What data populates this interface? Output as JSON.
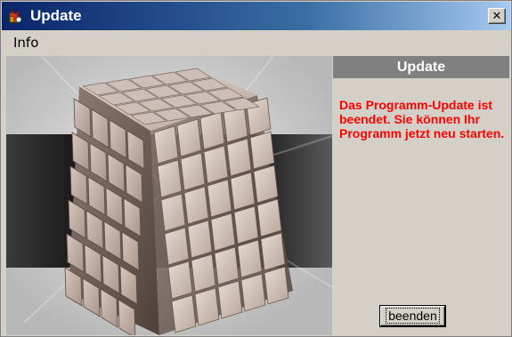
{
  "window": {
    "title": "Update",
    "title_icon": "update-app-icon",
    "close_icon": "close-icon",
    "close_glyph": "✕"
  },
  "menu": {
    "items": [
      {
        "label": "Info"
      }
    ]
  },
  "image": {
    "subject": "cube-image"
  },
  "panel": {
    "header": "Update",
    "message": "Das Programm-Update ist beendet. Sie können Ihr Programm jetzt neu starten.",
    "finish_button_label": "beenden"
  },
  "colors": {
    "title_gradient_start": "#0a246a",
    "title_gradient_end": "#a6caf0",
    "message_color": "#ff0000",
    "panel_header_bg": "#808080",
    "window_bg": "#d4d0c8"
  }
}
